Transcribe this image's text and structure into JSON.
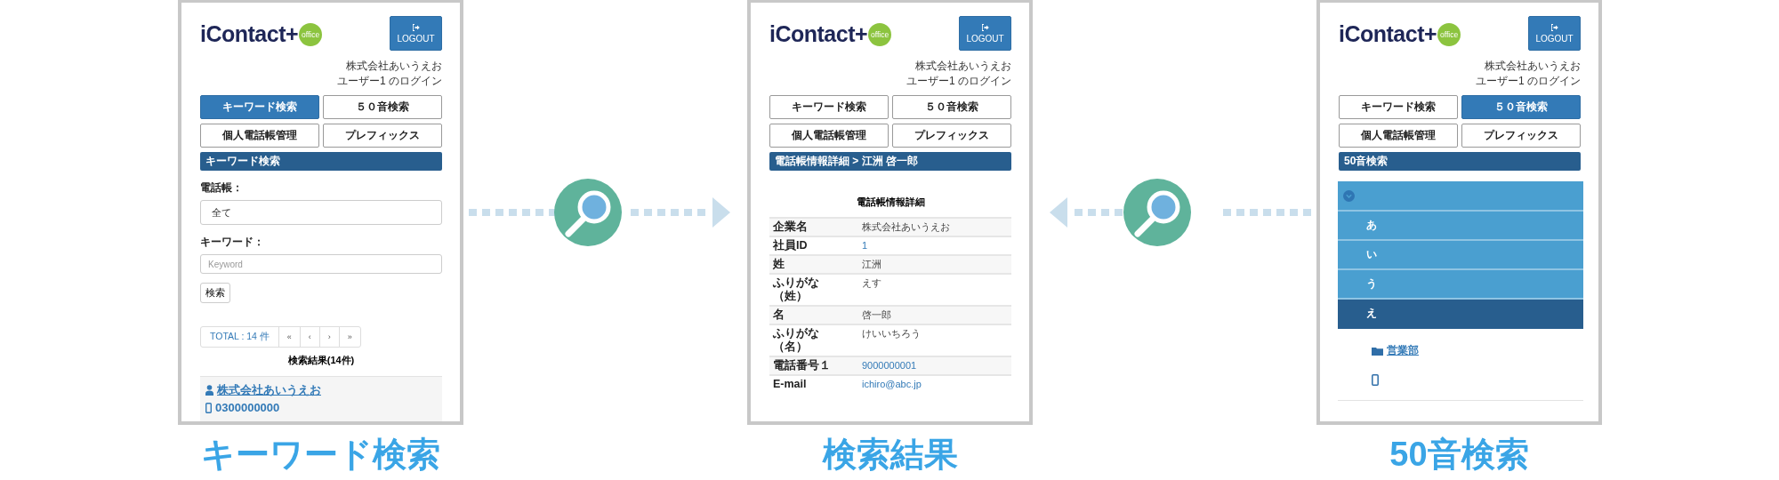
{
  "screens": [
    {
      "kind": "keyword",
      "header": {
        "logo": "iContact+",
        "badge": "office",
        "logout": "LOGOUT",
        "company": "株式会社あいうえお",
        "user": "ユーザー1 のログイン"
      },
      "tabs": [
        {
          "label": "キーワード検索",
          "selected": true
        },
        {
          "label": "５０音検索",
          "selected": false
        },
        {
          "label": "個人電話帳管理",
          "selected": false
        },
        {
          "label": "プレフィックス",
          "selected": false
        }
      ],
      "section_title": "キーワード検索",
      "fields": [
        {
          "label": "電話帳：",
          "value": "全て"
        },
        {
          "label": "キーワード：",
          "placeholder": "Keyword"
        }
      ],
      "search_button": "検索",
      "pagination": {
        "total": "TOTAL : 14 件",
        "buttons": [
          "«",
          "‹",
          "›",
          "»"
        ]
      },
      "results_title": "検索結果(14件)",
      "results": [
        {
          "name": "株式会社あいうえお",
          "phone": "0300000000"
        }
      ],
      "caption": "キーワード検索"
    },
    {
      "kind": "detail",
      "header": {
        "logo": "iContact+",
        "badge": "office",
        "logout": "LOGOUT",
        "company": "株式会社あいうえお",
        "user": "ユーザー1 のログイン"
      },
      "tabs": [
        {
          "label": "キーワード検索",
          "selected": false
        },
        {
          "label": "５０音検索",
          "selected": false
        },
        {
          "label": "個人電話帳管理",
          "selected": false
        },
        {
          "label": "プレフィックス",
          "selected": false
        }
      ],
      "section_title": "電話帳情報詳細 > 江洲 啓一郎",
      "detail_title": "電話帳情報詳細",
      "rows": [
        {
          "label": "企業名",
          "value": "株式会社あいうえお",
          "kind": "text"
        },
        {
          "label": "社員ID",
          "value": "1",
          "kind": "link"
        },
        {
          "label": "姓",
          "value": "江洲",
          "kind": "text"
        },
        {
          "label": "ふりがな",
          "label_note": "（姓）",
          "value": "えす",
          "kind": "text"
        },
        {
          "label": "名",
          "value": "啓一郎",
          "kind": "text"
        },
        {
          "label": "ふりがな",
          "label_note": "（名）",
          "value": "けいいちろう",
          "kind": "text"
        },
        {
          "label": "電話番号１",
          "value": "9000000001",
          "kind": "link"
        },
        {
          "label": "E-mail",
          "value": "ichiro@abc.jp",
          "kind": "link"
        }
      ],
      "caption": "検索結果"
    },
    {
      "kind": "kana",
      "header": {
        "logo": "iContact+",
        "badge": "office",
        "logout": "LOGOUT",
        "company": "株式会社あいうえお",
        "user": "ユーザー1 のログイン"
      },
      "tabs": [
        {
          "label": "キーワード検索",
          "selected": false
        },
        {
          "label": "５０音検索",
          "selected": true
        },
        {
          "label": "個人電話帳管理",
          "selected": false
        },
        {
          "label": "プレフィックス",
          "selected": false
        }
      ],
      "section_title": "50音検索",
      "accordion": {
        "expanded": true,
        "items": [
          {
            "label": "あ",
            "selected": false
          },
          {
            "label": "い",
            "selected": false
          },
          {
            "label": "う",
            "selected": false
          },
          {
            "label": "え",
            "selected": true
          }
        ]
      },
      "group": "営業部",
      "caption": "50音検索"
    }
  ]
}
